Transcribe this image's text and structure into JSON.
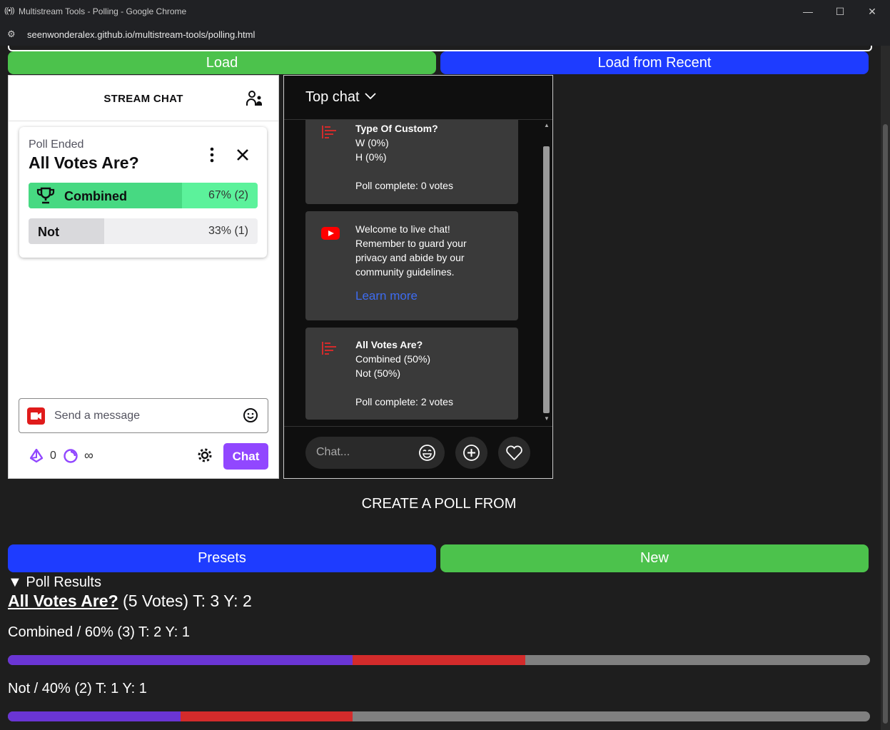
{
  "browser": {
    "window_title": "Multistream Tools - Polling - Google Chrome",
    "url": "seenwonderalex.github.io/multistream-tools/polling.html",
    "minimize": "—",
    "maximize": "☐",
    "close": "✕",
    "app_icon": "((•))",
    "site_settings_icon": "⚙"
  },
  "top_buttons": {
    "load": "Load",
    "load_recent": "Load from Recent"
  },
  "twitch": {
    "header_title": "STREAM CHAT",
    "poll": {
      "status": "Poll Ended",
      "question": "All Votes Are?",
      "options": [
        {
          "label": "Combined",
          "percent_text": "67% (2)",
          "fraction": 0.67,
          "winner": true
        },
        {
          "label": "Not",
          "percent_text": "33% (1)",
          "fraction": 0.33,
          "winner": false
        }
      ]
    },
    "message_placeholder": "Send a message",
    "bits_count": "0",
    "infinity": "∞",
    "chat_button": "Chat",
    "colors": {
      "accent": "#9147ff",
      "win_fill": "#47d982",
      "win_bg": "#5cf29b",
      "lose_fill": "#d9d9dc"
    }
  },
  "youtube": {
    "header_title": "Top chat",
    "messages": [
      {
        "lines": [
          "Type Of Custom?",
          "W (0%)",
          "H (0%)",
          "",
          "Poll complete: 0 votes"
        ],
        "icon": "poll-icon"
      },
      {
        "lines": [
          "Welcome to live chat!",
          "Remember to guard your",
          "privacy and abide by our",
          "community guidelines."
        ],
        "link": "Learn more",
        "icon": "youtube-icon"
      },
      {
        "lines": [
          "All Votes Are?",
          "Combined (50%)",
          "Not (50%)",
          "",
          "Poll complete: 2 votes"
        ],
        "icon": "poll-icon"
      }
    ],
    "chat_placeholder": "Chat..."
  },
  "create_poll_label": "CREATE A POLL FROM",
  "bottom_buttons": {
    "presets": "Presets",
    "new": "New"
  },
  "results": {
    "summary": "▼ Poll Results",
    "question": "All Votes Are?",
    "total": "(5 Votes) T: 3 Y: 2",
    "options": [
      {
        "text": "Combined / 60% (3) T: 2 Y: 1",
        "twitch_fraction": 0.4,
        "youtube_fraction": 0.2
      },
      {
        "text": "Not / 40% (2) T: 1 Y: 1",
        "twitch_fraction": 0.2,
        "youtube_fraction": 0.2
      }
    ],
    "colors": {
      "twitch": "#6a35d4",
      "youtube": "#d32b2b",
      "track": "#808080"
    }
  }
}
